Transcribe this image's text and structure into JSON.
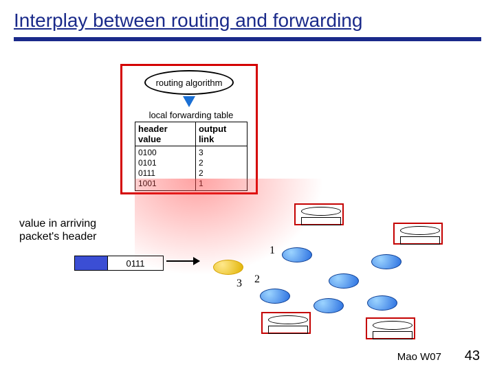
{
  "slide": {
    "title": "Interplay between routing and forwarding"
  },
  "routing": {
    "oval_label": "routing algorithm"
  },
  "table": {
    "caption": "local forwarding table",
    "col1": "header value",
    "col2": "output link",
    "hv": "0100\n0101\n0111\n1001",
    "ol": "3\n2\n2\n1"
  },
  "arriving": {
    "label": "value in arriving\npacket's header",
    "header_value": "0111"
  },
  "links": {
    "l1": "1",
    "l2": "2",
    "l3": "3"
  },
  "footer": {
    "author": "Mao W07",
    "page": "43"
  },
  "chart_data": {
    "type": "table",
    "title": "local forwarding table",
    "columns": [
      "header value",
      "output link"
    ],
    "rows": [
      [
        "0100",
        3
      ],
      [
        "0101",
        2
      ],
      [
        "0111",
        2
      ],
      [
        "1001",
        1
      ]
    ],
    "annotations": {
      "routing_source": "routing algorithm",
      "incoming_packet_header": "0111",
      "link_labels": [
        1,
        2,
        3
      ]
    }
  }
}
